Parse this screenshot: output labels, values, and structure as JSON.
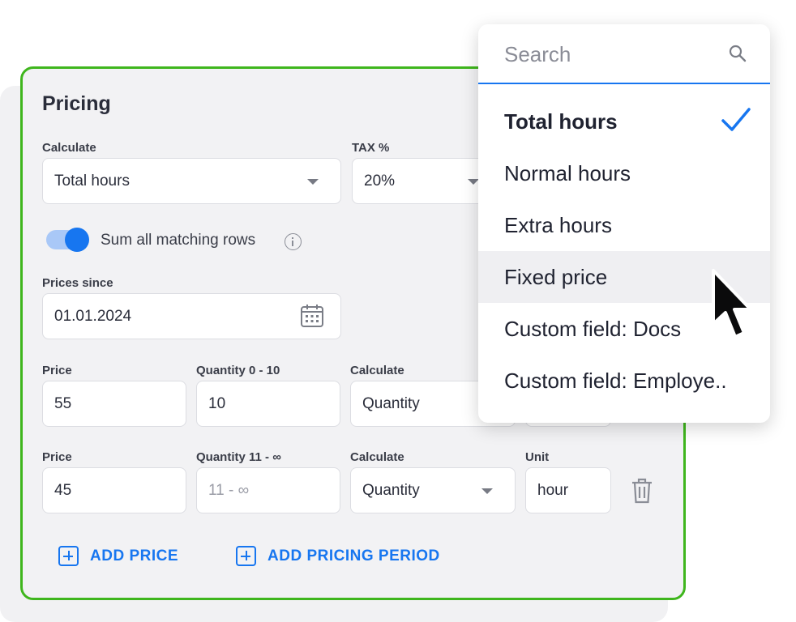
{
  "pricing": {
    "title": "Pricing",
    "calculate_label": "Calculate",
    "calculate_value": "Total hours",
    "tax_label": "TAX %",
    "tax_value": "20%",
    "toggle_label": "Sum all matching rows",
    "toggle_on": true,
    "prices_since_label": "Prices since",
    "prices_since_value": "01.01.2024",
    "rows": [
      {
        "price_label": "Price",
        "price_value": "55",
        "quantity_label": "Quantity 0 - 10",
        "quantity_value": "10",
        "calculate_label": "Calculate",
        "calculate_value": "Quantity"
      },
      {
        "price_label": "Price",
        "price_value": "45",
        "quantity_label": "Quantity 11 - ∞",
        "quantity_placeholder": "11 - ∞",
        "calculate_label": "Calculate",
        "calculate_value": "Quantity",
        "unit_label": "Unit",
        "unit_value": "hour"
      }
    ],
    "add_price_label": "ADD PRICE",
    "add_period_label": "ADD PRICING PERIOD"
  },
  "dropdown": {
    "search_placeholder": "Search",
    "items": [
      {
        "label": "Total hours",
        "selected": true
      },
      {
        "label": "Normal hours"
      },
      {
        "label": "Extra hours"
      },
      {
        "label": "Fixed price",
        "hovered": true
      },
      {
        "label": "Custom field: Docs"
      },
      {
        "label": "Custom field: Employe.."
      }
    ]
  },
  "colors": {
    "accent": "#1776f0",
    "card_border": "#3fb61d",
    "card_background": "#f2f2f4"
  },
  "icons": [
    "info-icon",
    "calendar-icon",
    "caret-down-icon",
    "trash-icon",
    "plus-square-icon",
    "search-icon",
    "check-icon",
    "cursor-icon"
  ]
}
